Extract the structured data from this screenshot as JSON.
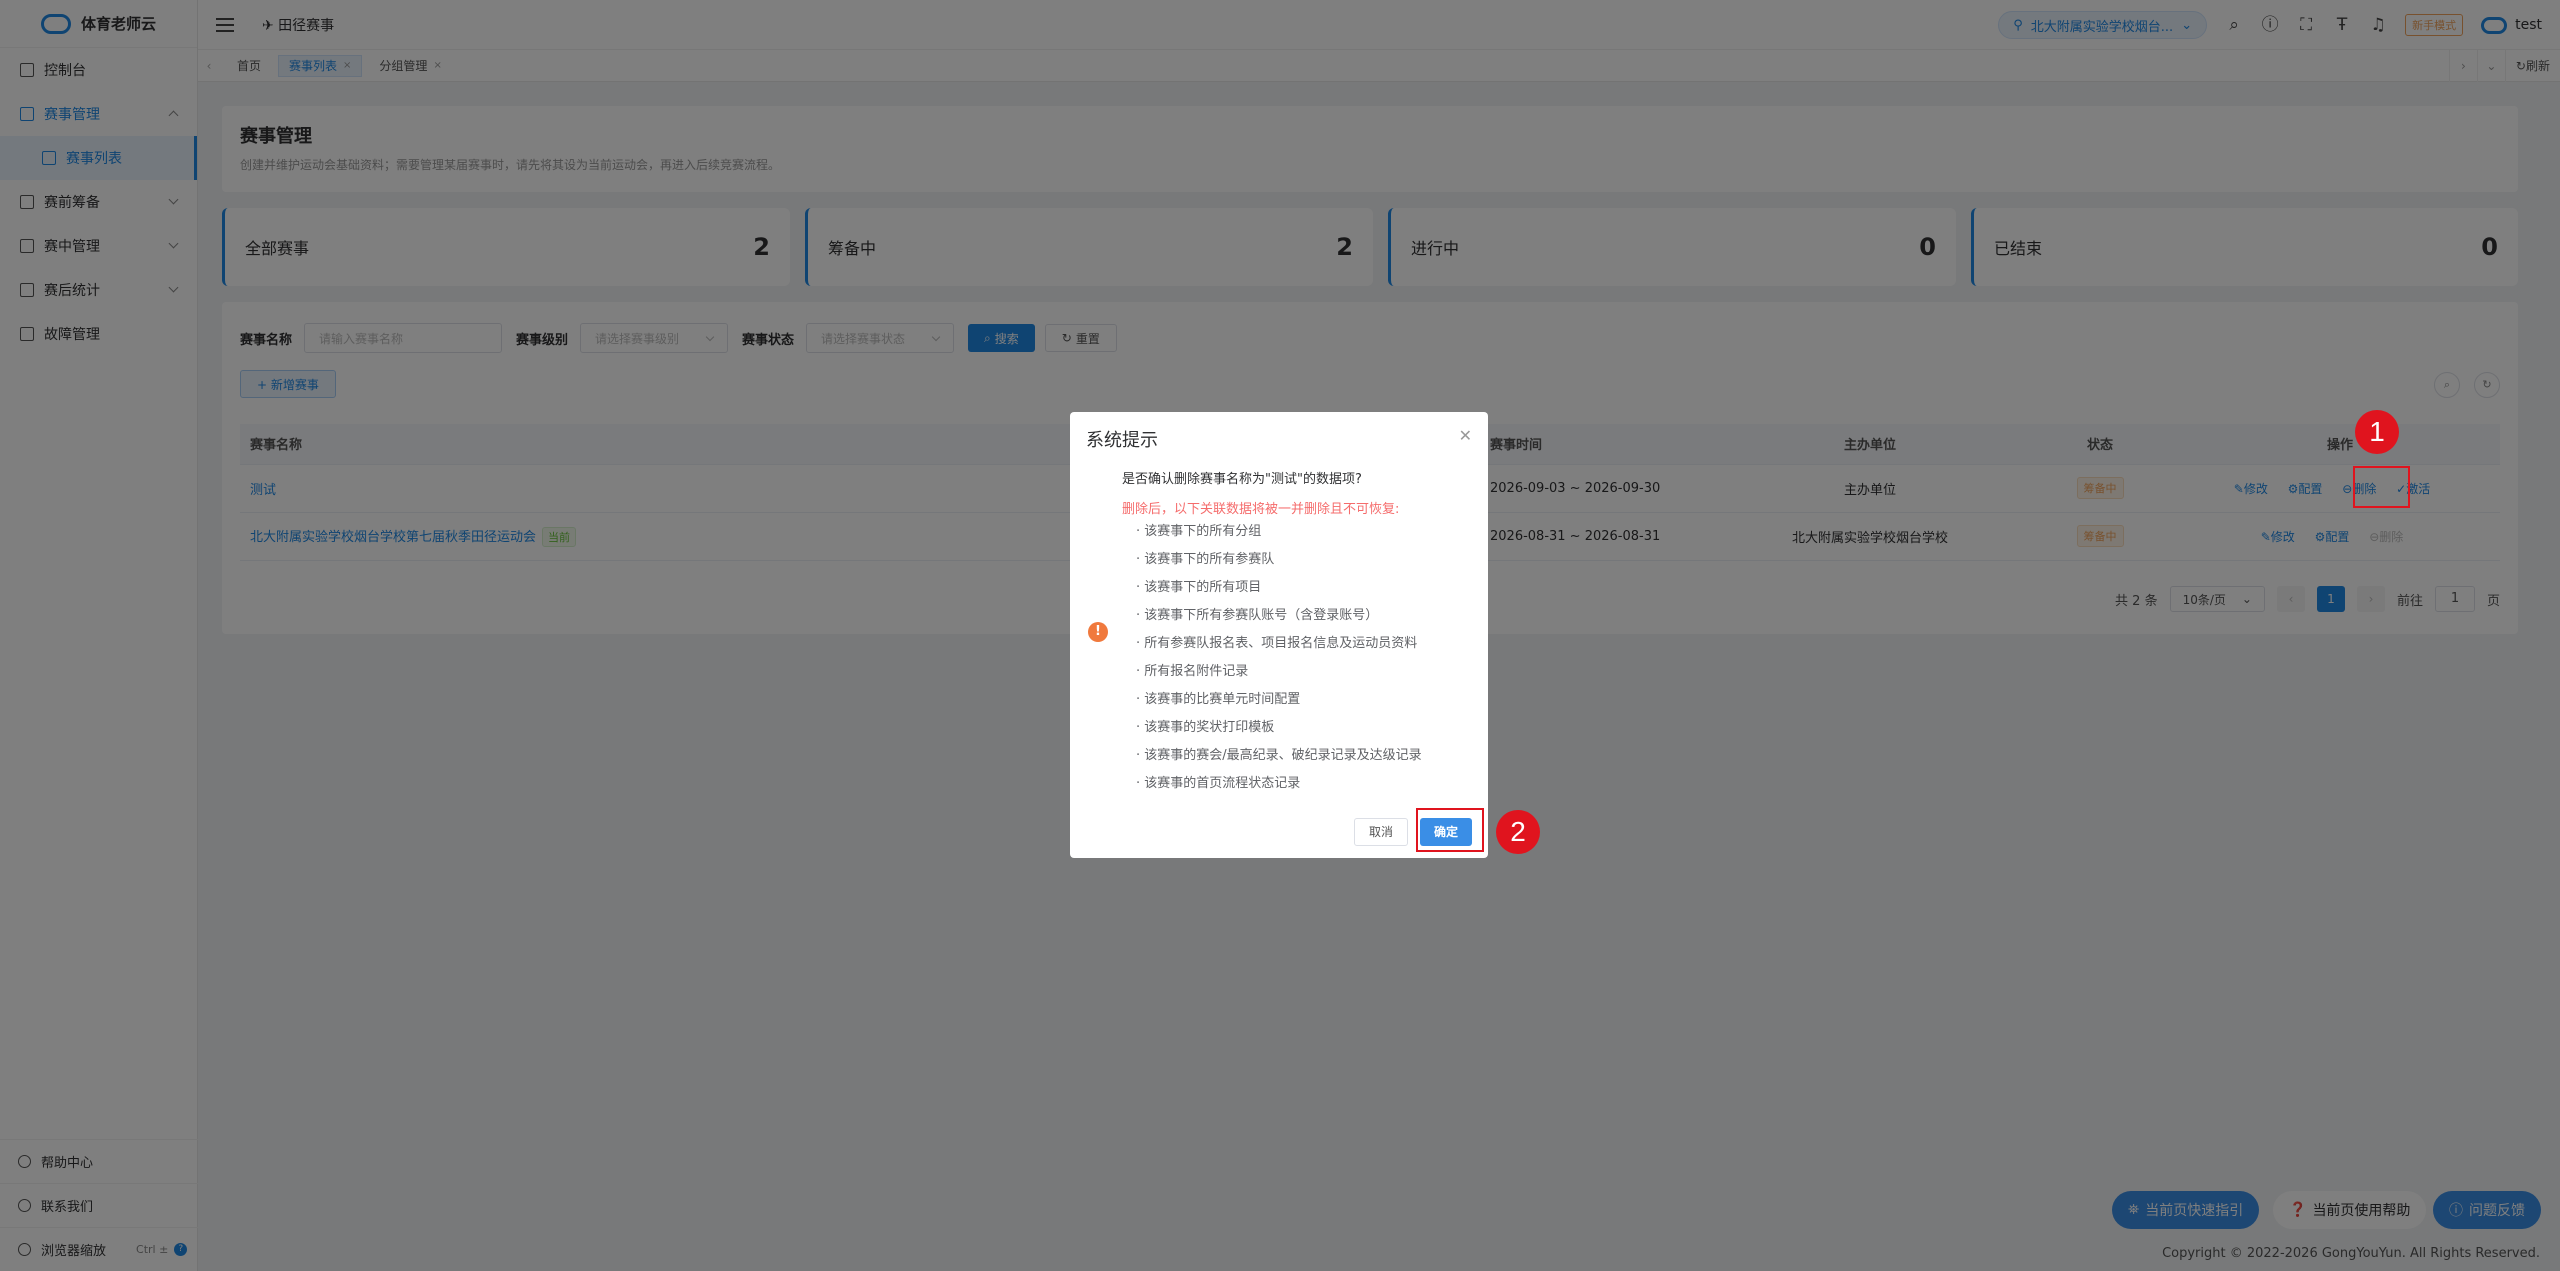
{
  "app": {
    "name": "体育老师云"
  },
  "sidebar": {
    "items": [
      {
        "label": "控制台"
      },
      {
        "label": "赛事管理"
      },
      {
        "label": "赛事列表"
      },
      {
        "label": "赛前筹备"
      },
      {
        "label": "赛中管理"
      },
      {
        "label": "赛后统计"
      },
      {
        "label": "故障管理"
      }
    ],
    "bottom": {
      "help": "帮助中心",
      "contact": "联系我们",
      "zoom": "浏览器缩放",
      "zoom_kbd": "Ctrl ±",
      "zoom_q": "?"
    }
  },
  "header": {
    "breadcrumb": "✈ 田径赛事",
    "school": "北大附属实验学校烟台...",
    "newbie": "新手模式",
    "user": "test"
  },
  "tabs": {
    "items": [
      "首页",
      "赛事列表",
      "分组管理"
    ],
    "refresh": "刷新"
  },
  "page": {
    "title": "赛事管理",
    "desc": "创建并维护运动会基础资料；需要管理某届赛事时，请先将其设为当前运动会，再进入后续竞赛流程。"
  },
  "stats": [
    {
      "label": "全部赛事",
      "value": "2"
    },
    {
      "label": "筹备中",
      "value": "2"
    },
    {
      "label": "进行中",
      "value": "0"
    },
    {
      "label": "已结束",
      "value": "0"
    }
  ],
  "filters": {
    "name_label": "赛事名称",
    "name_placeholder": "请输入赛事名称",
    "level_label": "赛事级别",
    "level_placeholder": "请选择赛事级别",
    "status_label": "赛事状态",
    "status_placeholder": "请选择赛事状态",
    "search": "搜索",
    "reset": "重置",
    "add": "+ 新增赛事"
  },
  "table": {
    "headers": [
      "赛事名称",
      "赛事时间",
      "主办单位",
      "状态",
      "操作"
    ],
    "rows": [
      {
        "name": "测试",
        "current": "",
        "time": "2026-09-03 ~ 2026-09-30",
        "host": "主办单位",
        "status": "筹备中",
        "ops": [
          "修改",
          "配置",
          "删除",
          "激活"
        ]
      },
      {
        "name": "北大附属实验学校烟台学校第七届秋季田径运动会",
        "current": "当前",
        "time": "2026-08-31 ~ 2026-08-31",
        "host": "北大附属实验学校烟台学校",
        "status": "筹备中",
        "ops": [
          "修改",
          "配置",
          "删除"
        ]
      }
    ]
  },
  "pager": {
    "total": "共 2 条",
    "size": "10条/页",
    "current": "1",
    "goto": "前往",
    "page_input": "1",
    "page_unit": "页"
  },
  "dialog": {
    "title": "系统提示",
    "question": "是否确认删除赛事名称为\"测试\"的数据项?",
    "warning": "删除后，以下关联数据将被一并删除且不可恢复:",
    "items": [
      "· 该赛事下的所有分组",
      "· 该赛事下的所有参赛队",
      "· 该赛事下的所有项目",
      "· 该赛事下所有参赛队账号（含登录账号）",
      "· 所有参赛队报名表、项目报名信息及运动员资料",
      "· 所有报名附件记录",
      "· 该赛事的比赛单元时间配置",
      "· 该赛事的奖状打印模板",
      "· 该赛事的赛会/最高纪录、破纪录记录及达级记录",
      "· 该赛事的首页流程状态记录"
    ],
    "cancel": "取消",
    "confirm": "确定"
  },
  "annotations": {
    "one": "1",
    "two": "2"
  },
  "fabs": {
    "guide": "当前页快速指引",
    "usage": "当前页使用帮助",
    "feedback": "问题反馈"
  },
  "footer": "Copyright © 2022-2026 GongYouYun. All Rights Reserved.",
  "colors": {
    "primary": "#1e88e5",
    "warning": "#f0a35c",
    "danger": "#f56c6c",
    "annotation": "#e0141e"
  }
}
